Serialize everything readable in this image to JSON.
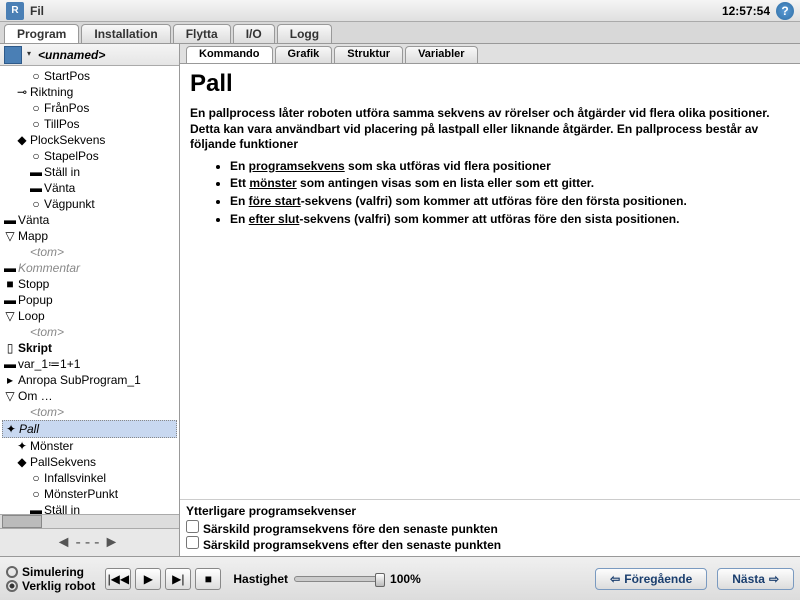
{
  "topbar": {
    "menu": "Fil",
    "time": "12:57:54"
  },
  "main_tabs": [
    "Program",
    "Installation",
    "Flytta",
    "I/O",
    "Logg"
  ],
  "file_name": "<unnamed>",
  "tree": [
    {
      "t": "StartPos",
      "i": "○",
      "c": "ind2",
      "cl": ""
    },
    {
      "t": "Riktning",
      "i": "⊸",
      "c": "ind1",
      "cl": ""
    },
    {
      "t": "FrånPos",
      "i": "○",
      "c": "ind2",
      "cl": ""
    },
    {
      "t": "TillPos",
      "i": "○",
      "c": "ind2",
      "cl": ""
    },
    {
      "t": "PlockSekvens",
      "i": "◆",
      "c": "ind1",
      "cl": ""
    },
    {
      "t": "StapelPos",
      "i": "○",
      "c": "ind2",
      "cl": ""
    },
    {
      "t": "Ställ in",
      "i": "▬",
      "c": "ind2",
      "cl": ""
    },
    {
      "t": "Vänta",
      "i": "▬",
      "c": "ind2",
      "cl": ""
    },
    {
      "t": "Vägpunkt",
      "i": "○",
      "c": "ind2",
      "cl": ""
    },
    {
      "t": "Vänta",
      "i": "▬",
      "c": "",
      "cl": ""
    },
    {
      "t": "Mapp",
      "i": "▽",
      "c": "",
      "cl": ""
    },
    {
      "t": "<tom>",
      "i": "",
      "c": "ind1",
      "cl": "grey"
    },
    {
      "t": "Kommentar",
      "i": "▬",
      "c": "",
      "cl": "grey"
    },
    {
      "t": "Stopp",
      "i": "■",
      "c": "",
      "cl": ""
    },
    {
      "t": "Popup",
      "i": "▬",
      "c": "",
      "cl": ""
    },
    {
      "t": "Loop",
      "i": "▽",
      "c": "",
      "cl": ""
    },
    {
      "t": "<tom>",
      "i": "",
      "c": "ind1",
      "cl": "grey"
    },
    {
      "t": "Skript",
      "i": "▯",
      "c": "",
      "cl": "",
      "b": true
    },
    {
      "t": "var_1≔1+1",
      "i": "▬",
      "c": "",
      "cl": ""
    },
    {
      "t": "Anropa SubProgram_1",
      "i": "▸",
      "c": "",
      "cl": ""
    },
    {
      "t": "Om …",
      "i": "▽",
      "c": "",
      "cl": ""
    },
    {
      "t": "<tom>",
      "i": "",
      "c": "ind1",
      "cl": "grey"
    },
    {
      "t": "Pall",
      "i": "✦",
      "c": "",
      "cl": "",
      "sel": true
    },
    {
      "t": "Mönster",
      "i": "✦",
      "c": "ind1",
      "cl": ""
    },
    {
      "t": "PallSekvens",
      "i": "◆",
      "c": "ind1",
      "cl": ""
    },
    {
      "t": "Infallsvinkel",
      "i": "○",
      "c": "ind2",
      "cl": ""
    },
    {
      "t": "MönsterPunkt",
      "i": "○",
      "c": "ind2",
      "cl": ""
    },
    {
      "t": "Ställ in",
      "i": "▬",
      "c": "ind2",
      "cl": ""
    }
  ],
  "sub_tabs": [
    "Kommando",
    "Grafik",
    "Struktur",
    "Variabler"
  ],
  "content": {
    "title": "Pall",
    "intro": "En pallprocess låter roboten utföra samma sekvens av rörelser och åtgärder vid flera olika positioner. Detta kan vara användbart vid placering på lastpall eller liknande åtgärder. En pallprocess består av följande funktioner",
    "b1a": "En ",
    "b1u": "programsekvens",
    "b1b": " som ska utföras vid flera positioner",
    "b2a": "Ett ",
    "b2u": "mönster",
    "b2b": " som antingen visas som en lista eller som ett gitter.",
    "b3a": "En ",
    "b3u": "före start",
    "b3b": "-sekvens (valfri) som kommer att utföras före den första positionen.",
    "b4a": "En ",
    "b4u": "efter slut",
    "b4b": "-sekvens (valfri) som kommer att utföras före den sista positionen."
  },
  "extras": {
    "header": "Ytterligare programsekvenser",
    "cb1": "Särskild programsekvens före den senaste punkten",
    "cb2": "Särskild programsekvens efter den senaste punkten"
  },
  "bottom": {
    "sim": "Simulering",
    "real": "Verklig robot",
    "speed_label": "Hastighet",
    "speed_value": "100%",
    "prev": "Föregående",
    "next": "Nästa"
  }
}
